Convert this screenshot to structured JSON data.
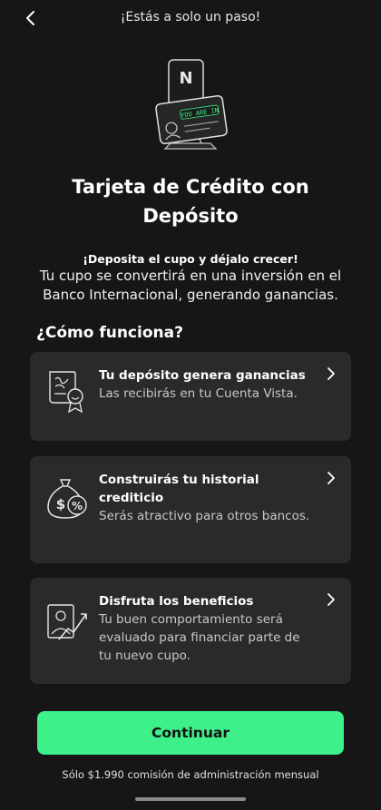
{
  "header": {
    "title": "¡Estás a solo un paso!"
  },
  "hero": {
    "card_text": "YOU ARE IN",
    "brand_letter": "N"
  },
  "title": "Tarjeta de Crédito con Depósito",
  "subtitle_bold": "¡Deposita el cupo y déjalo crecer!",
  "subtitle": "Tu cupo se convertirá en una inversión en el Banco Internacional, generando ganancias.",
  "section_title": "¿Cómo funciona?",
  "cards": [
    {
      "title": "Tu depósito genera ganancias",
      "description": "Las recibirás en tu Cuenta Vista.",
      "icon": "certificate-icon"
    },
    {
      "title": "Construirás tu historial crediticio",
      "description": "Serás atractivo para otros bancos.",
      "icon": "money-bag-icon"
    },
    {
      "title": "Disfruta los beneficios",
      "description": "Tu buen comportamiento será evaluado para financiar parte de tu nuevo cupo.",
      "icon": "growth-chart-icon"
    }
  ],
  "cta": {
    "label": "Continuar"
  },
  "footnote": "Sólo $1.990 comisión de administración mensual",
  "colors": {
    "background": "#161616",
    "card": "#2a2a2a",
    "accent": "#3ef08a"
  }
}
